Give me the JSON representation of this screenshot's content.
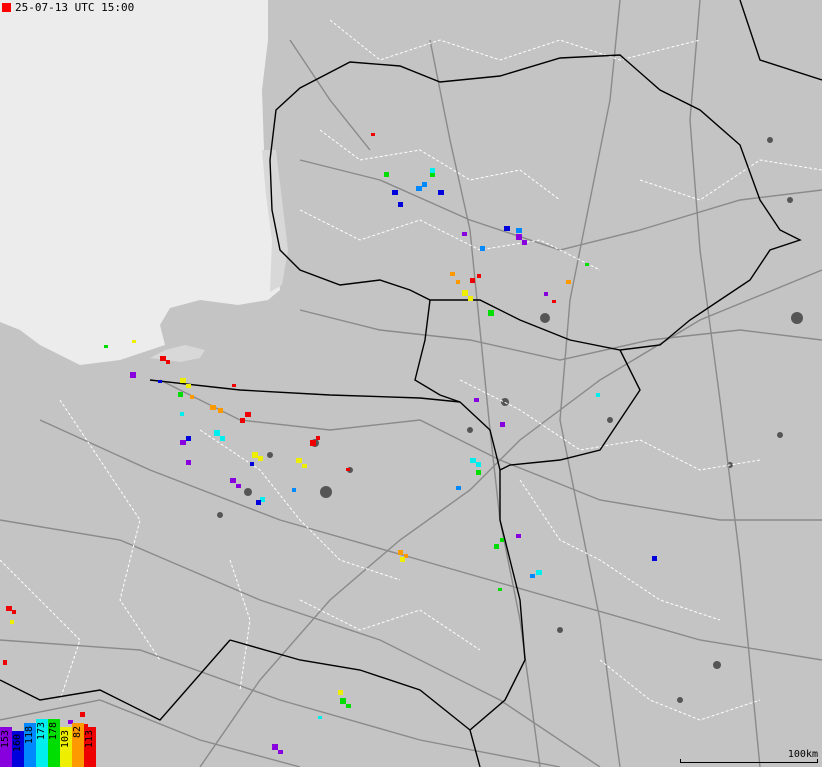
{
  "timestamp": {
    "text": "25-07-13 UTC 15:00",
    "marker_color": "#ff0000"
  },
  "legend": [
    {
      "label": "153",
      "color": "#8800dd"
    },
    {
      "label": "160",
      "color": "#0000dd"
    },
    {
      "label": "118",
      "color": "#0088ff"
    },
    {
      "label": "173",
      "color": "#00eeee"
    },
    {
      "label": "178",
      "color": "#00dd00"
    },
    {
      "label": "103",
      "color": "#eeee00"
    },
    {
      "label": "82",
      "color": "#ff9900"
    },
    {
      "label": "113",
      "color": "#ee0000"
    }
  ],
  "scale": {
    "label": "100km"
  },
  "colors": {
    "sea": "#ececec",
    "land": "#c4c4c4",
    "border": "#000000",
    "road": "#8a8a8a",
    "admin": "#ffffff",
    "lake": "#555555"
  }
}
